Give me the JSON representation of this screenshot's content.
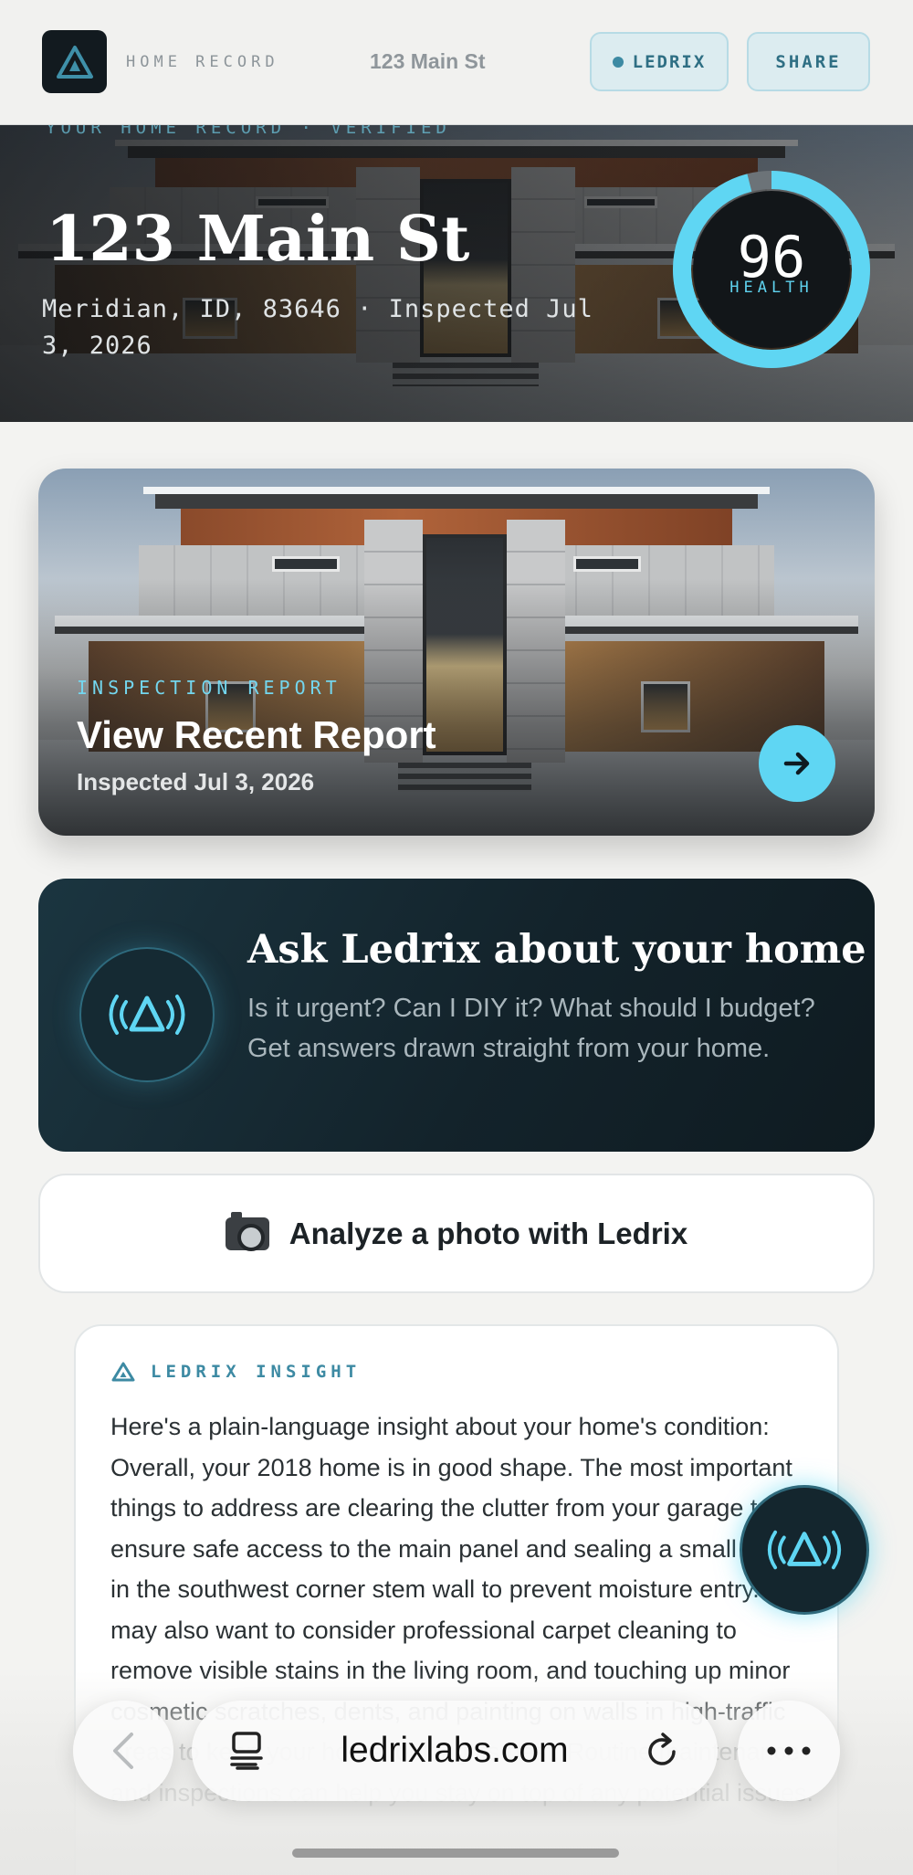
{
  "nav": {
    "brand": "HOME RECORD",
    "address": "123 Main St",
    "ledrix_label": "LEDRIX",
    "share_label": "SHARE"
  },
  "hero": {
    "eyebrow": "YOUR HOME RECORD · VERIFIED",
    "title": "123 Main St",
    "subtitle": "Meridian, ID, 83646 · Inspected Jul 3, 2026",
    "health_score": "96",
    "health_fraction": 0.96,
    "health_label": "HEALTH"
  },
  "report": {
    "eyebrow": "INSPECTION REPORT",
    "title": "View Recent Report",
    "date": "Inspected Jul 3, 2026"
  },
  "ask": {
    "title": "Ask Ledrix about your home",
    "body": "Is it urgent? Can I DIY it? What should I budget? Get answers drawn straight from your home."
  },
  "analyze": {
    "label": "Analyze a photo with Ledrix"
  },
  "insight": {
    "label": "LEDRIX INSIGHT",
    "body": "Here's a plain-language insight about your home's condition: Overall, your 2018 home is in good shape. The most important things to address are clearing the clutter from your garage to ensure safe access to the main panel and sealing a small crack in the southwest corner stem wall to prevent moisture entry. You may also want to consider professional carpet cleaning to remove visible stains in the living room, and touching up minor cosmetic scratches, dents, and painting on walls in high-traffic areas to keep your home looking its best. Routine maintenance and inspections can help you stay on top of any potential issues."
  },
  "browser": {
    "url": "ledrixlabs.com"
  },
  "colors": {
    "accent": "#5fd6f3",
    "dark_panel": "#13232b",
    "teal_text": "#3d8aa3"
  },
  "icons": {
    "logo": "ledrix-triangle-logo",
    "arrow": "arrow-right-icon",
    "assistant": "ledrix-signal-icon",
    "camera": "camera-icon",
    "tabs": "tab-overview-icon",
    "reload": "reload-icon",
    "more": "more-dots-icon",
    "back": "chevron-left-icon"
  }
}
